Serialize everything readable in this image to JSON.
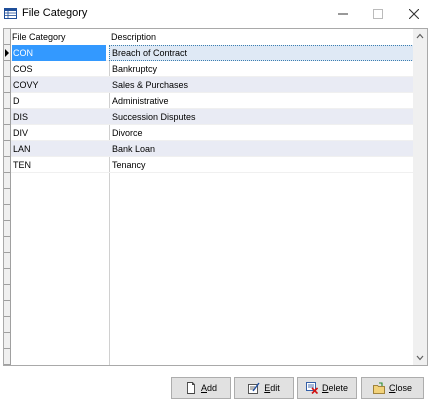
{
  "window": {
    "title": "File Category",
    "icon": "table-window-icon"
  },
  "grid": {
    "columns": [
      "File Category",
      "Description"
    ],
    "selected_index": 0,
    "rows": [
      {
        "category": "CON",
        "description": "Breach of Contract"
      },
      {
        "category": "COS",
        "description": "Bankruptcy"
      },
      {
        "category": "COVY",
        "description": "Sales & Purchases"
      },
      {
        "category": "D",
        "description": "Administrative"
      },
      {
        "category": "DIS",
        "description": "Succession Disputes"
      },
      {
        "category": "DIV",
        "description": "Divorce"
      },
      {
        "category": "LAN",
        "description": "Bank Loan"
      },
      {
        "category": "TEN",
        "description": "Tenancy"
      }
    ]
  },
  "buttons": {
    "add": {
      "mnemonic": "A",
      "rest": "dd",
      "icon": "document-icon"
    },
    "edit": {
      "mnemonic": "E",
      "rest": "dit",
      "icon": "edit-icon"
    },
    "delete": {
      "mnemonic": "D",
      "rest": "elete",
      "icon": "delete-icon"
    },
    "close": {
      "mnemonic": "C",
      "rest": "lose",
      "icon": "folder-icon"
    }
  },
  "colors": {
    "selection": "#3399ff",
    "alt_row": "#e9ebf4"
  }
}
